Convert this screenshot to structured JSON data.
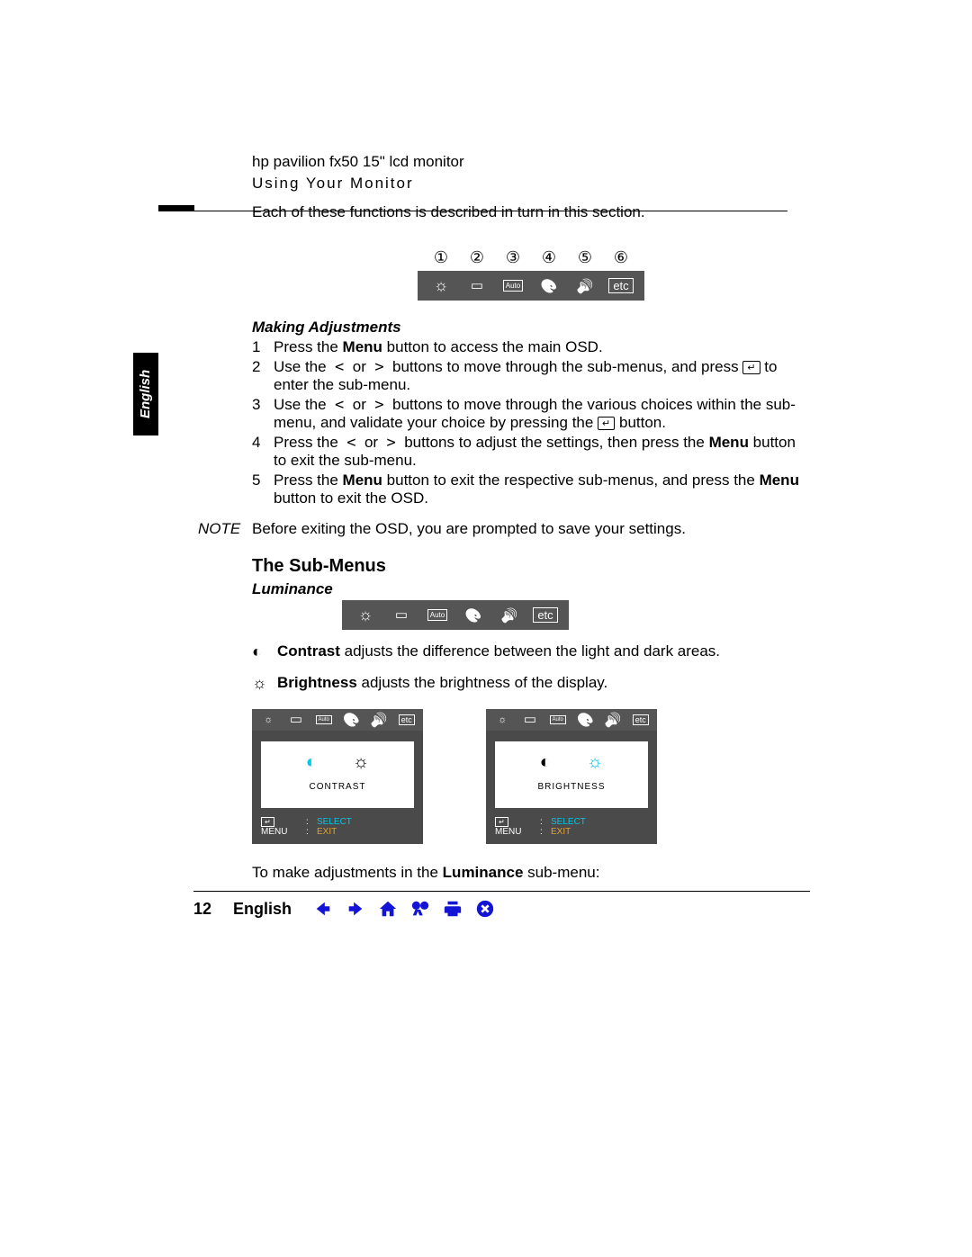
{
  "header": {
    "product": "hp pavilion fx50 15\" lcd monitor",
    "section": "Using Your Monitor"
  },
  "sidebar_tab": "English",
  "intro": "Each of these functions is described in turn in this section.",
  "osd_numbers": [
    "①",
    "②",
    "③",
    "④",
    "⑤",
    "⑥"
  ],
  "osd_main": {
    "auto": "Auto",
    "etc": "etc"
  },
  "making_adjustments": {
    "title": "Making Adjustments",
    "steps": [
      {
        "n": "1",
        "pre": "Press the ",
        "b": "Menu",
        "post": " button to access the main OSD."
      },
      {
        "n": "2",
        "html": "Use the  <  or  >  buttons to move through the sub-menus, and press ↵ to enter the sub-menu."
      },
      {
        "n": "3",
        "html": "Use the  <  or  >  buttons to move through the various choices within the sub-menu, and validate your choice by pressing the ↵ button."
      },
      {
        "n": "4",
        "pre": "Press the  <  or  >  buttons to adjust the settings, then press the ",
        "b": "Menu",
        "post": " button to exit the sub-menu."
      },
      {
        "n": "5",
        "pre": "Press the ",
        "b": "Menu",
        "mid": " button to exit the respective sub-menus, and press the ",
        "b2": "Menu",
        "post": " button to exit the OSD."
      }
    ]
  },
  "note": {
    "label": "NOTE",
    "text": "Before exiting the OSD, you are prompted to save your settings."
  },
  "sub_menus": {
    "heading": "The Sub-Menus",
    "luminance": "Luminance",
    "contrast": {
      "term": "Contrast",
      "desc": " adjusts the difference between the light and dark areas."
    },
    "brightness": {
      "term": "Brightness",
      "desc": " adjusts the brightness of the display."
    }
  },
  "panels": {
    "left": {
      "label": "CONTRAST",
      "sel": "SELECT",
      "exit": "EXIT",
      "menu": "MENU"
    },
    "right": {
      "label": "BRIGHTNESS",
      "sel": "SELECT",
      "exit": "EXIT",
      "menu": "MENU"
    }
  },
  "closing": {
    "pre": "To make adjustments in the ",
    "b": "Luminance",
    "post": " sub-menu:"
  },
  "footer": {
    "page": "12",
    "lang": "English"
  }
}
